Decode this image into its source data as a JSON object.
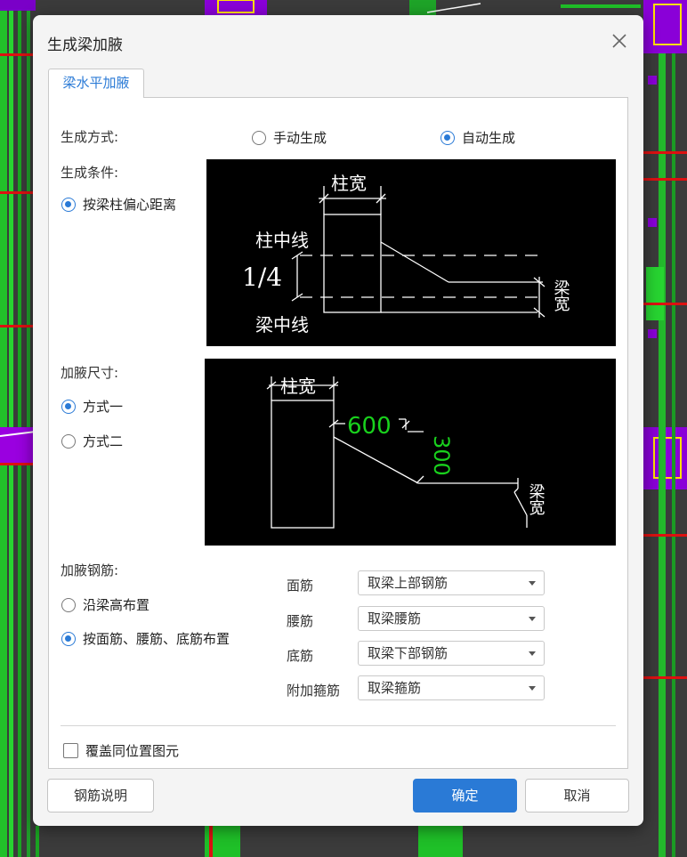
{
  "dialog": {
    "title": "生成梁加腋",
    "tab_label": "梁水平加腋",
    "generate_mode": {
      "label": "生成方式:",
      "options": [
        "手动生成",
        "自动生成"
      ],
      "selected": "自动生成"
    },
    "generate_condition": {
      "label": "生成条件:",
      "option": "按梁柱偏心距离",
      "selected": true
    },
    "diagram1": {
      "column_width": "柱宽",
      "column_centerline": "柱中线",
      "ratio": "1/4",
      "beam_centerline": "梁中线",
      "beam_width": "梁宽"
    },
    "haunch_size": {
      "label": "加腋尺寸:",
      "options": [
        "方式一",
        "方式二"
      ],
      "selected": "方式一"
    },
    "diagram2": {
      "column_width": "柱宽",
      "length": "600",
      "width": "300",
      "beam_width": "梁宽"
    },
    "haunch_rebar": {
      "label": "加腋钢筋:",
      "options": [
        "沿梁高布置",
        "按面筋、腰筋、底筋布置"
      ],
      "selected": "按面筋、腰筋、底筋布置",
      "rows": [
        {
          "label": "面筋",
          "value": "取梁上部钢筋"
        },
        {
          "label": "腰筋",
          "value": "取梁腰筋"
        },
        {
          "label": "底筋",
          "value": "取梁下部钢筋"
        },
        {
          "label": "附加箍筋",
          "value": "取梁箍筋"
        }
      ]
    },
    "override_checkbox": "覆盖同位置图元",
    "buttons": {
      "rebar_help": "钢筋说明",
      "ok": "确定",
      "cancel": "取消"
    },
    "colors": {
      "accent": "#2a7ad6",
      "dimension_green": "#19d11d"
    }
  }
}
